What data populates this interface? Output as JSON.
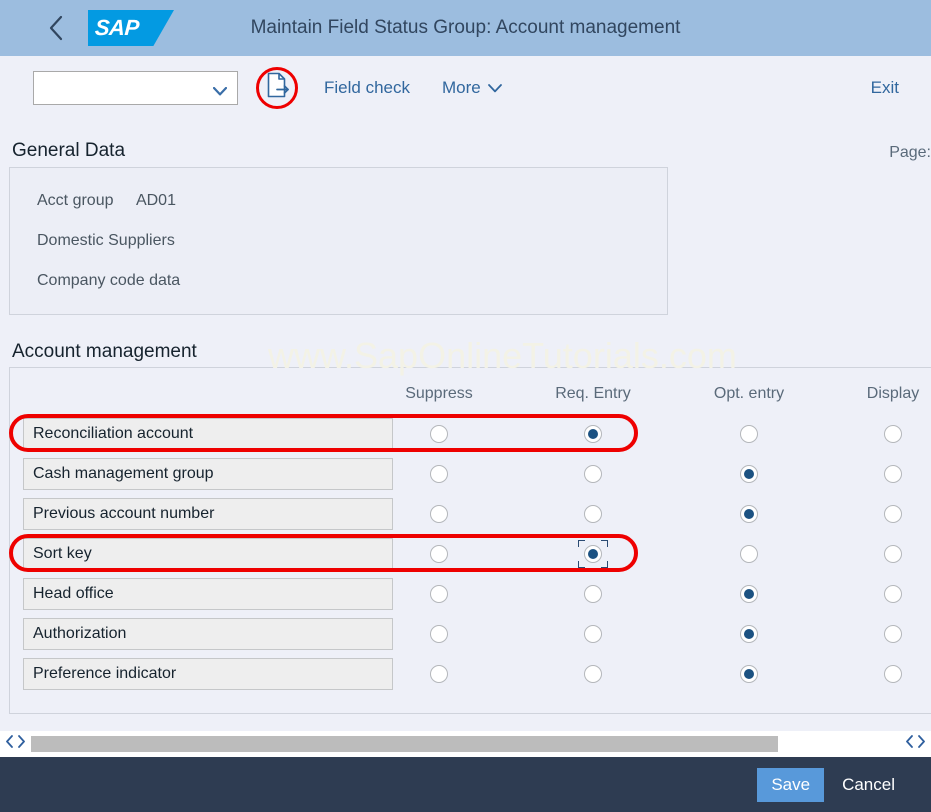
{
  "shell": {
    "back_icon": "chevron-left-icon",
    "logo_text": "SAP",
    "title": "Maintain Field Status Group: Account management"
  },
  "toolbar": {
    "select_value": "",
    "select_placeholder": "",
    "export_icon": "document-export-icon",
    "field_check_label": "Field check",
    "more_label": "More",
    "exit_label": "Exit"
  },
  "watermark": "www.SapOnlineTutorials.com",
  "general_data": {
    "section_title": "General Data",
    "page_label": "Page:",
    "rows": [
      {
        "label": "Acct group",
        "value": "AD01"
      },
      {
        "label": "Domestic Suppliers",
        "value": ""
      },
      {
        "label": "Company code data",
        "value": ""
      }
    ]
  },
  "account_management": {
    "section_title": "Account management",
    "columns": [
      "Suppress",
      "Req. Entry",
      "Opt. entry",
      "Display"
    ],
    "rows": [
      {
        "label": "Reconciliation account",
        "selected": "Req. Entry",
        "highlighted": true,
        "focused": false
      },
      {
        "label": "Cash management group",
        "selected": "Opt. entry",
        "highlighted": false,
        "focused": false
      },
      {
        "label": "Previous account number",
        "selected": "Opt. entry",
        "highlighted": false,
        "focused": false
      },
      {
        "label": "Sort key",
        "selected": "Req. Entry",
        "highlighted": true,
        "focused": true
      },
      {
        "label": "Head office",
        "selected": "Opt. entry",
        "highlighted": false,
        "focused": false
      },
      {
        "label": "Authorization",
        "selected": "Opt. entry",
        "highlighted": false,
        "focused": false
      },
      {
        "label": "Preference indicator",
        "selected": "Opt. entry",
        "highlighted": false,
        "focused": false
      }
    ]
  },
  "scrollbar": {
    "left_prev_icon": "chevron-left-icon",
    "left_next_icon": "chevron-right-icon",
    "right_prev_icon": "chevron-left-icon",
    "right_next_icon": "chevron-right-icon",
    "thumb_percent": 86
  },
  "footer": {
    "save_label": "Save",
    "cancel_label": "Cancel"
  },
  "colors": {
    "header_bg": "#9cbddf",
    "sap_blue": "#039ae2",
    "page_bg": "#eef0f8",
    "link": "#31679e",
    "radio_selected": "#1c5282",
    "annotation_red": "#ee0000",
    "footer_bg": "#2e3c52",
    "save_blue": "#5899da"
  }
}
